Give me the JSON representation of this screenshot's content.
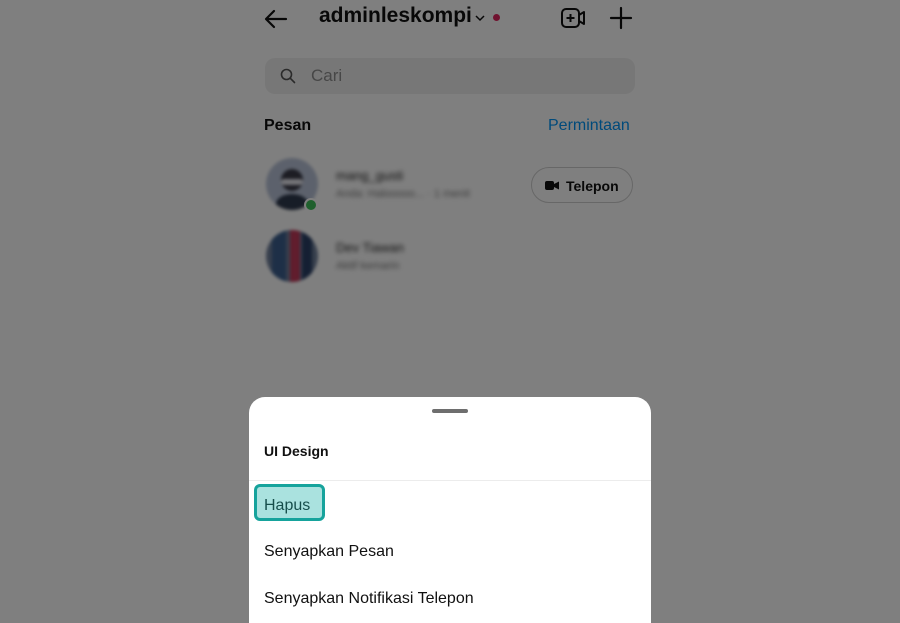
{
  "header": {
    "username": "adminleskompi",
    "icons": {
      "back": "arrow-left-icon",
      "dropdown": "chevron-down-icon",
      "new_video": "video-add-icon",
      "new_message": "plus-icon"
    },
    "notification_dot_color": "#e0245e"
  },
  "search": {
    "placeholder": "Cari",
    "icon": "search-icon"
  },
  "messages": {
    "title": "Pesan",
    "requests_label": "Permintaan",
    "requests_color": "#0095f6",
    "threads": [
      {
        "name": "mang_gusti",
        "subtitle": "Anda: Halooooo... · 1 menit",
        "online": true,
        "call_label": "Telepon"
      },
      {
        "name": "Dev Tiawan",
        "subtitle": "Aktif kemarin",
        "online": false
      }
    ]
  },
  "sheet": {
    "title": "UI Design",
    "items": [
      "Hapus",
      "Senyapkan Pesan",
      "Senyapkan Notifikasi Telepon"
    ],
    "highlight_color": "#16a39c"
  }
}
